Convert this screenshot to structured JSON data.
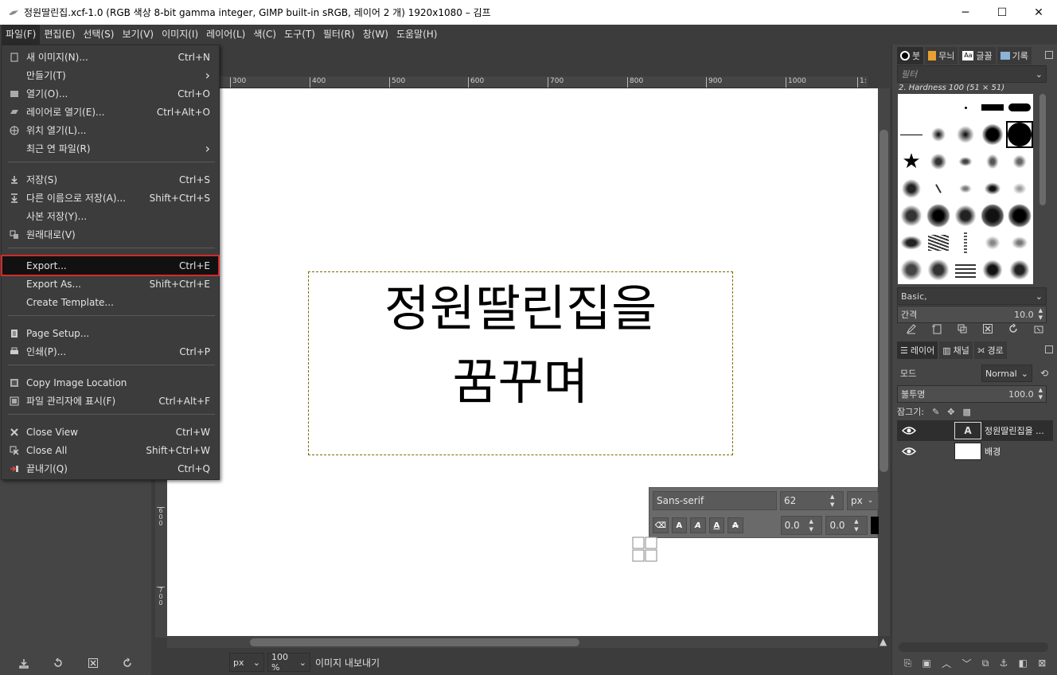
{
  "window": {
    "title": "정원딸린집.xcf-1.0 (RGB 색상 8-bit gamma integer, GIMP built-in sRGB, 레이어 2 개) 1920x1080 – 김프",
    "minimize": "─",
    "maximize": "☐",
    "close": "✕"
  },
  "menubar": [
    {
      "label": "파일(F)"
    },
    {
      "label": "편집(E)"
    },
    {
      "label": "선택(S)"
    },
    {
      "label": "보기(V)"
    },
    {
      "label": "이미지(I)"
    },
    {
      "label": "레이어(L)"
    },
    {
      "label": "색(C)"
    },
    {
      "label": "도구(T)"
    },
    {
      "label": "필터(R)"
    },
    {
      "label": "창(W)"
    },
    {
      "label": "도움말(H)"
    }
  ],
  "file_menu": {
    "items": [
      {
        "label": "새 이미지(N)...",
        "accel": "Ctrl+N",
        "icon": "new-image-icon"
      },
      {
        "label": "만들기(T)",
        "accel": "›",
        "icon": ""
      },
      {
        "label": "열기(O)...",
        "accel": "Ctrl+O",
        "icon": "open-icon"
      },
      {
        "label": "레이어로 열기(E)...",
        "accel": "Ctrl+Alt+O",
        "icon": "open-as-layers-icon"
      },
      {
        "label": "위치 열기(L)...",
        "accel": "",
        "icon": "open-location-icon"
      },
      {
        "label": "최근 연 파일(R)",
        "accel": "›",
        "icon": ""
      },
      {
        "label": "저장(S)",
        "accel": "Ctrl+S",
        "icon": "save-icon"
      },
      {
        "label": "다른 이름으로 저장(A)...",
        "accel": "Shift+Ctrl+S",
        "icon": "save-as-icon"
      },
      {
        "label": "사본 저장(Y)...",
        "accel": "",
        "icon": ""
      },
      {
        "label": "원래대로(V)",
        "accel": "",
        "icon": "revert-icon"
      },
      {
        "label": "Export...",
        "accel": "Ctrl+E",
        "icon": ""
      },
      {
        "label": "Export As...",
        "accel": "Shift+Ctrl+E",
        "icon": ""
      },
      {
        "label": "Create Template...",
        "accel": "",
        "icon": ""
      },
      {
        "label": "Page Setup...",
        "accel": "",
        "icon": "page-setup-icon"
      },
      {
        "label": "인쇄(P)...",
        "accel": "Ctrl+P",
        "icon": "print-icon"
      },
      {
        "label": "Copy Image Location",
        "accel": "",
        "icon": "copy-location-icon"
      },
      {
        "label": "파일 관리자에 표시(F)",
        "accel": "Ctrl+Alt+F",
        "icon": "file-manager-icon"
      },
      {
        "label": "Close View",
        "accel": "Ctrl+W",
        "icon": "close-view-icon"
      },
      {
        "label": "Close All",
        "accel": "Shift+Ctrl+W",
        "icon": "close-all-icon"
      },
      {
        "label": "끝내기(Q)",
        "accel": "Ctrl+Q",
        "icon": "quit-icon"
      }
    ]
  },
  "ruler": {
    "h_ticks": [
      "300",
      "400",
      "500",
      "600",
      "700",
      "800",
      "900",
      "1000",
      "1:"
    ],
    "v_labels": [
      "6\n0\n0",
      "7\n0\n0"
    ]
  },
  "canvas": {
    "text_line1": "정원딸린집을",
    "text_line2": "꿈꾸며"
  },
  "text_tool": {
    "font": "Sans-serif",
    "size": "62",
    "unit": "px",
    "baseline": "0.0",
    "kerning": "0.0"
  },
  "statusbar": {
    "unit": "px",
    "zoom": "100 %",
    "message": "이미지 내보내기"
  },
  "brushes_panel": {
    "tabs": [
      {
        "label": "붓",
        "icon": "brush-icon"
      },
      {
        "label": "무늬",
        "icon": "pattern-icon"
      },
      {
        "label": "글꼴",
        "icon": "font-icon"
      },
      {
        "label": "기록",
        "icon": "history-icon"
      }
    ],
    "filter_placeholder": "필터",
    "brush_info": "2. Hardness 100 (51 × 51)",
    "preset": "Basic,",
    "spacing_label": "간격",
    "spacing_value": "10.0"
  },
  "layers_panel": {
    "tabs": [
      {
        "label": "레이어",
        "icon": "layers-icon"
      },
      {
        "label": "채널",
        "icon": "channels-icon"
      },
      {
        "label": "경로",
        "icon": "paths-icon"
      }
    ],
    "mode_label": "모드",
    "mode_value": "Normal",
    "opacity_label": "불투명",
    "opacity_value": "100.0",
    "lock_label": "잠그기:",
    "layers": [
      {
        "name": "정원딸린집을 ...",
        "type": "text"
      },
      {
        "name": "배경",
        "type": "background"
      }
    ]
  }
}
